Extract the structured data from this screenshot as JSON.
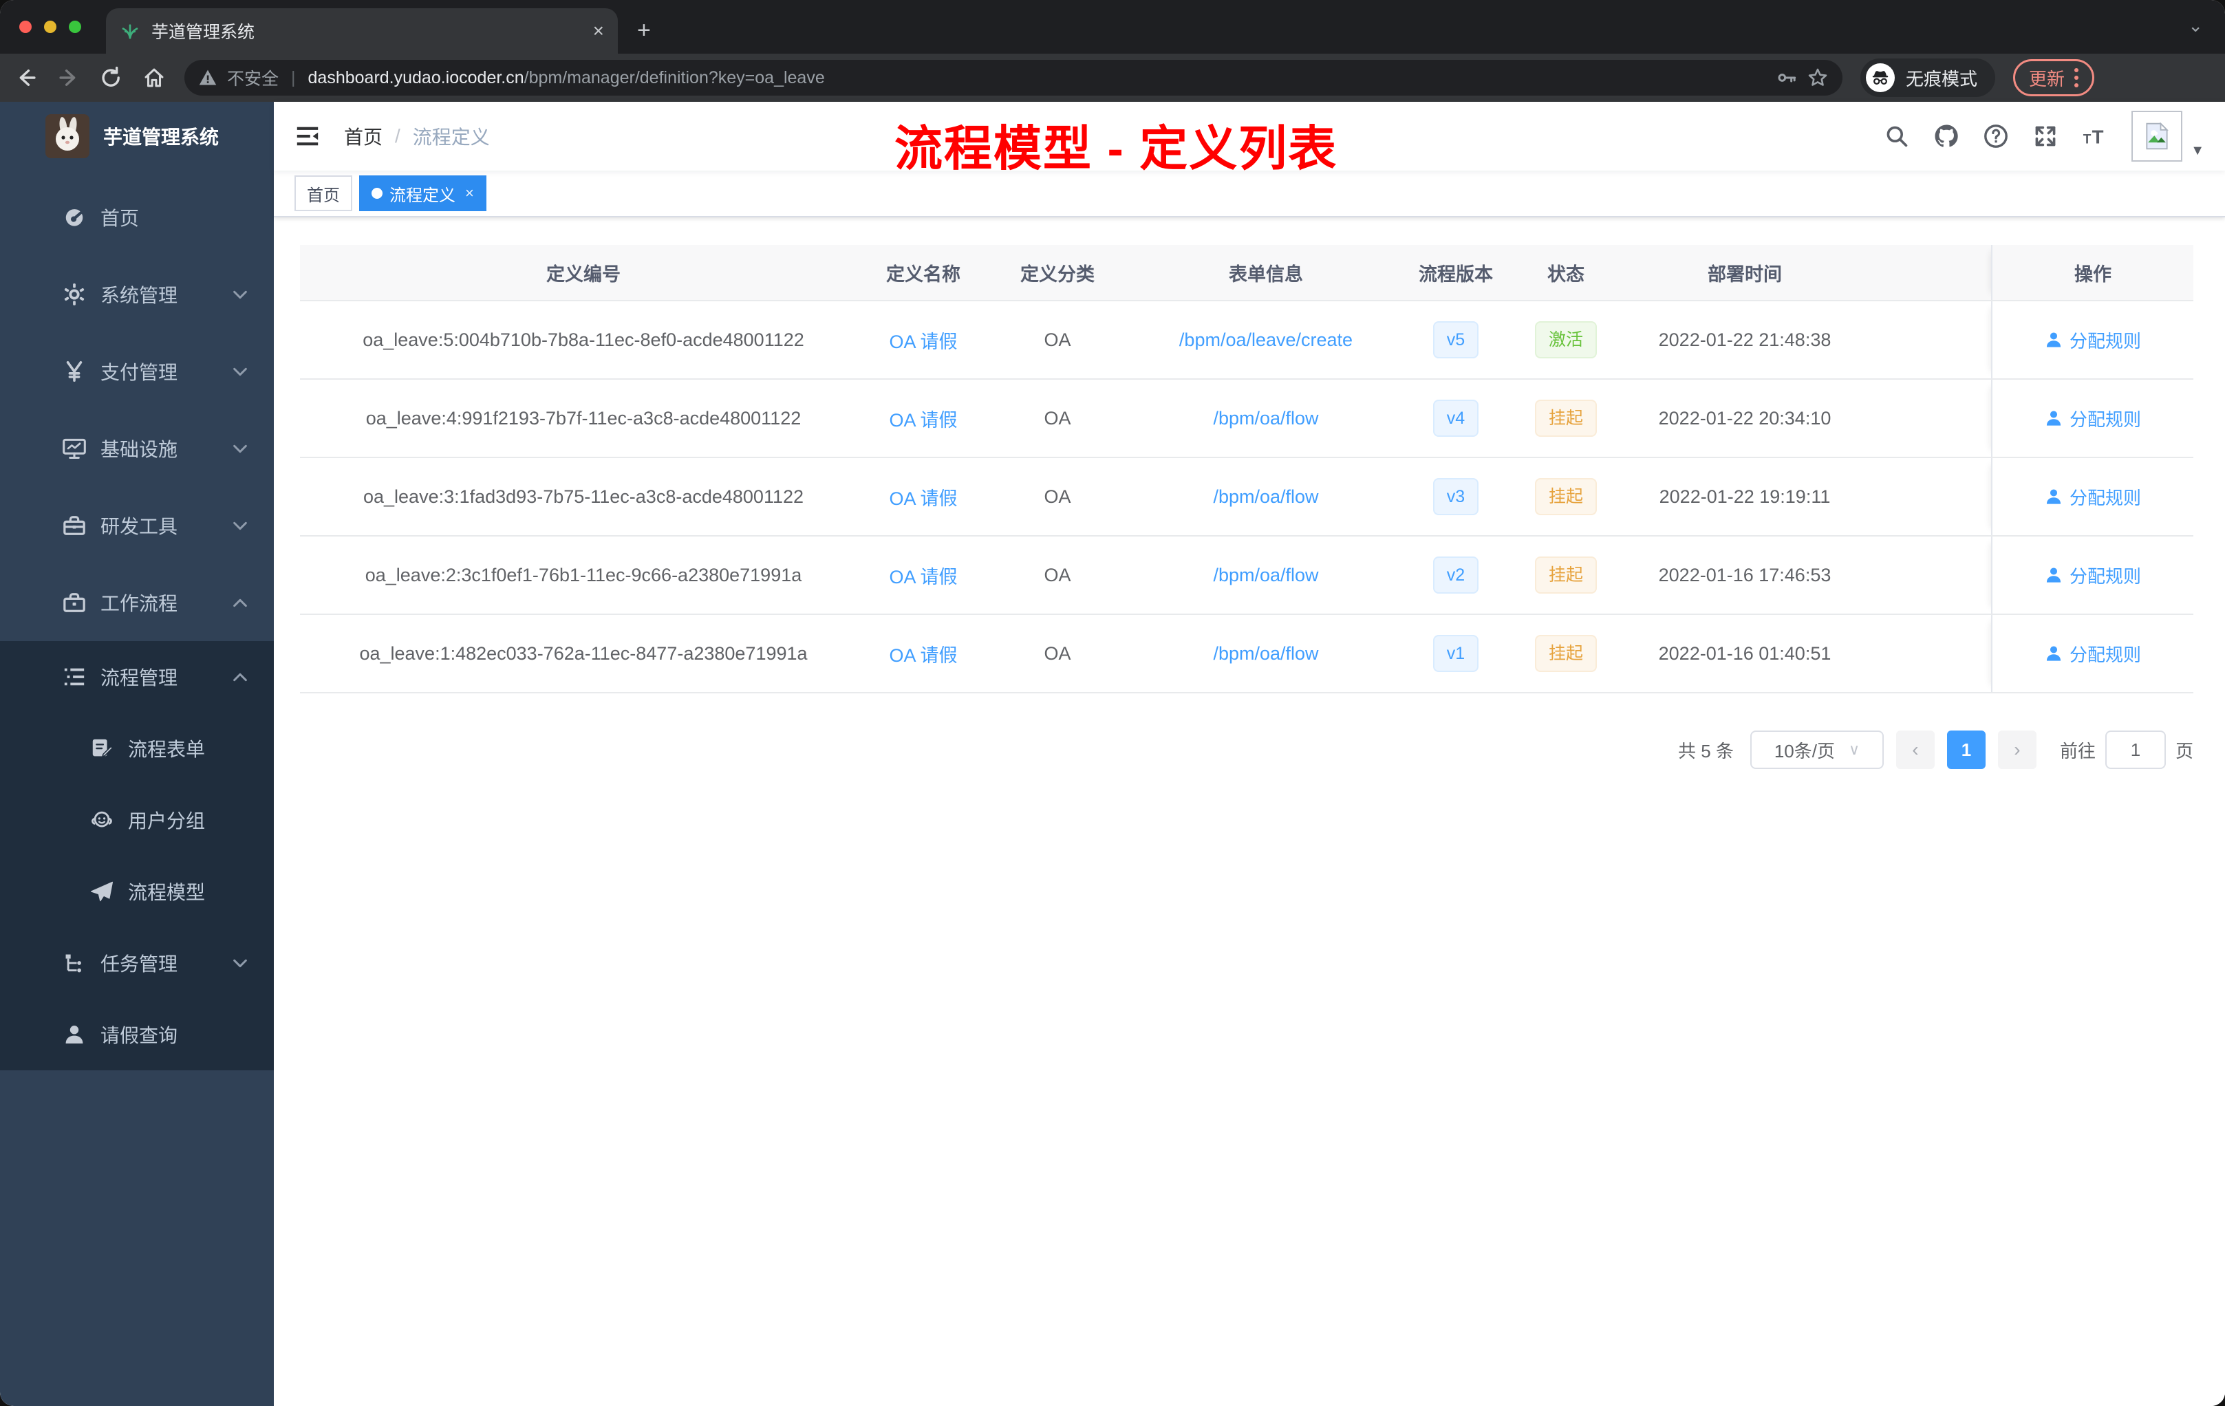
{
  "browser": {
    "tab_title": "芋道管理系统",
    "close_tab": "×",
    "new_tab": "+",
    "overflow_caret": "⌄",
    "security_label": "不安全",
    "url_domain": "dashboard.yudao.iocoder.cn",
    "url_path": "/bpm/manager/definition?key=oa_leave",
    "incognito_label": "无痕模式",
    "update_label": "更新"
  },
  "sidebar": {
    "title": "芋道管理系统",
    "items": [
      {
        "label": "首页",
        "icon": "dashboard-icon",
        "depth": 1,
        "chevron": null,
        "sub": false
      },
      {
        "label": "系统管理",
        "icon": "gear-icon",
        "depth": 1,
        "chevron": "down",
        "sub": false
      },
      {
        "label": "支付管理",
        "icon": "yen-icon",
        "depth": 1,
        "chevron": "down",
        "sub": false
      },
      {
        "label": "基础设施",
        "icon": "monitor-icon",
        "depth": 1,
        "chevron": "down",
        "sub": false
      },
      {
        "label": "研发工具",
        "icon": "toolbox-icon",
        "depth": 1,
        "chevron": "down",
        "sub": false
      },
      {
        "label": "工作流程",
        "icon": "briefcase-icon",
        "depth": 1,
        "chevron": "up",
        "sub": false
      },
      {
        "label": "流程管理",
        "icon": "list-icon",
        "depth": 2,
        "chevron": "up",
        "sub": true
      },
      {
        "label": "流程表单",
        "icon": "form-icon",
        "depth": 3,
        "chevron": null,
        "sub": true
      },
      {
        "label": "用户分组",
        "icon": "group-icon",
        "depth": 3,
        "chevron": null,
        "sub": true
      },
      {
        "label": "流程模型",
        "icon": "plane-icon",
        "depth": 3,
        "chevron": null,
        "sub": true
      },
      {
        "label": "任务管理",
        "icon": "tree-icon",
        "depth": 2,
        "chevron": "down",
        "sub": true
      },
      {
        "label": "请假查询",
        "icon": "person-icon",
        "depth": 2,
        "chevron": null,
        "sub": true
      }
    ]
  },
  "header": {
    "breadcrumb": [
      "首页",
      "流程定义"
    ],
    "breadcrumb_separator": "/",
    "annotation": "流程模型 - 定义列表"
  },
  "tags": [
    {
      "label": "首页",
      "active": false,
      "close": null
    },
    {
      "label": "流程定义",
      "active": true,
      "close": "×"
    }
  ],
  "table": {
    "columns": [
      "定义编号",
      "定义名称",
      "定义分类",
      "表单信息",
      "流程版本",
      "状态",
      "部署时间",
      "操作"
    ],
    "rows": [
      {
        "id": "oa_leave:5:004b710b-7b8a-11ec-8ef0-acde48001122",
        "name": "OA 请假",
        "category": "OA",
        "form": "/bpm/oa/leave/create",
        "version": "v5",
        "status": "激活",
        "status_type": "success",
        "deploy_time": "2022-01-22 21:48:38",
        "action": "分配规则"
      },
      {
        "id": "oa_leave:4:991f2193-7b7f-11ec-a3c8-acde48001122",
        "name": "OA 请假",
        "category": "OA",
        "form": "/bpm/oa/flow",
        "version": "v4",
        "status": "挂起",
        "status_type": "warning",
        "deploy_time": "2022-01-22 20:34:10",
        "action": "分配规则"
      },
      {
        "id": "oa_leave:3:1fad3d93-7b75-11ec-a3c8-acde48001122",
        "name": "OA 请假",
        "category": "OA",
        "form": "/bpm/oa/flow",
        "version": "v3",
        "status": "挂起",
        "status_type": "warning",
        "deploy_time": "2022-01-22 19:19:11",
        "action": "分配规则"
      },
      {
        "id": "oa_leave:2:3c1f0ef1-76b1-11ec-9c66-a2380e71991a",
        "name": "OA 请假",
        "category": "OA",
        "form": "/bpm/oa/flow",
        "version": "v2",
        "status": "挂起",
        "status_type": "warning",
        "deploy_time": "2022-01-16 17:46:53",
        "action": "分配规则"
      },
      {
        "id": "oa_leave:1:482ec033-762a-11ec-8477-a2380e71991a",
        "name": "OA 请假",
        "category": "OA",
        "form": "/bpm/oa/flow",
        "version": "v1",
        "status": "挂起",
        "status_type": "warning",
        "deploy_time": "2022-01-16 01:40:51",
        "action": "分配规则"
      }
    ]
  },
  "pagination": {
    "total": "共 5 条",
    "page_size": "10条/页",
    "prev": "‹",
    "current_page": "1",
    "next": "›",
    "goto_label": "前往",
    "goto_value": "1",
    "page_unit": "页"
  },
  "colors": {
    "accent_blue": "#409eff",
    "success_green": "#67c23a",
    "warning_orange": "#e6a23c",
    "sidebar_bg": "#304156",
    "submenu_bg": "#1f2d3d",
    "annotation_red": "#ff0000",
    "active_tag_blue": "#2d8cf0"
  }
}
